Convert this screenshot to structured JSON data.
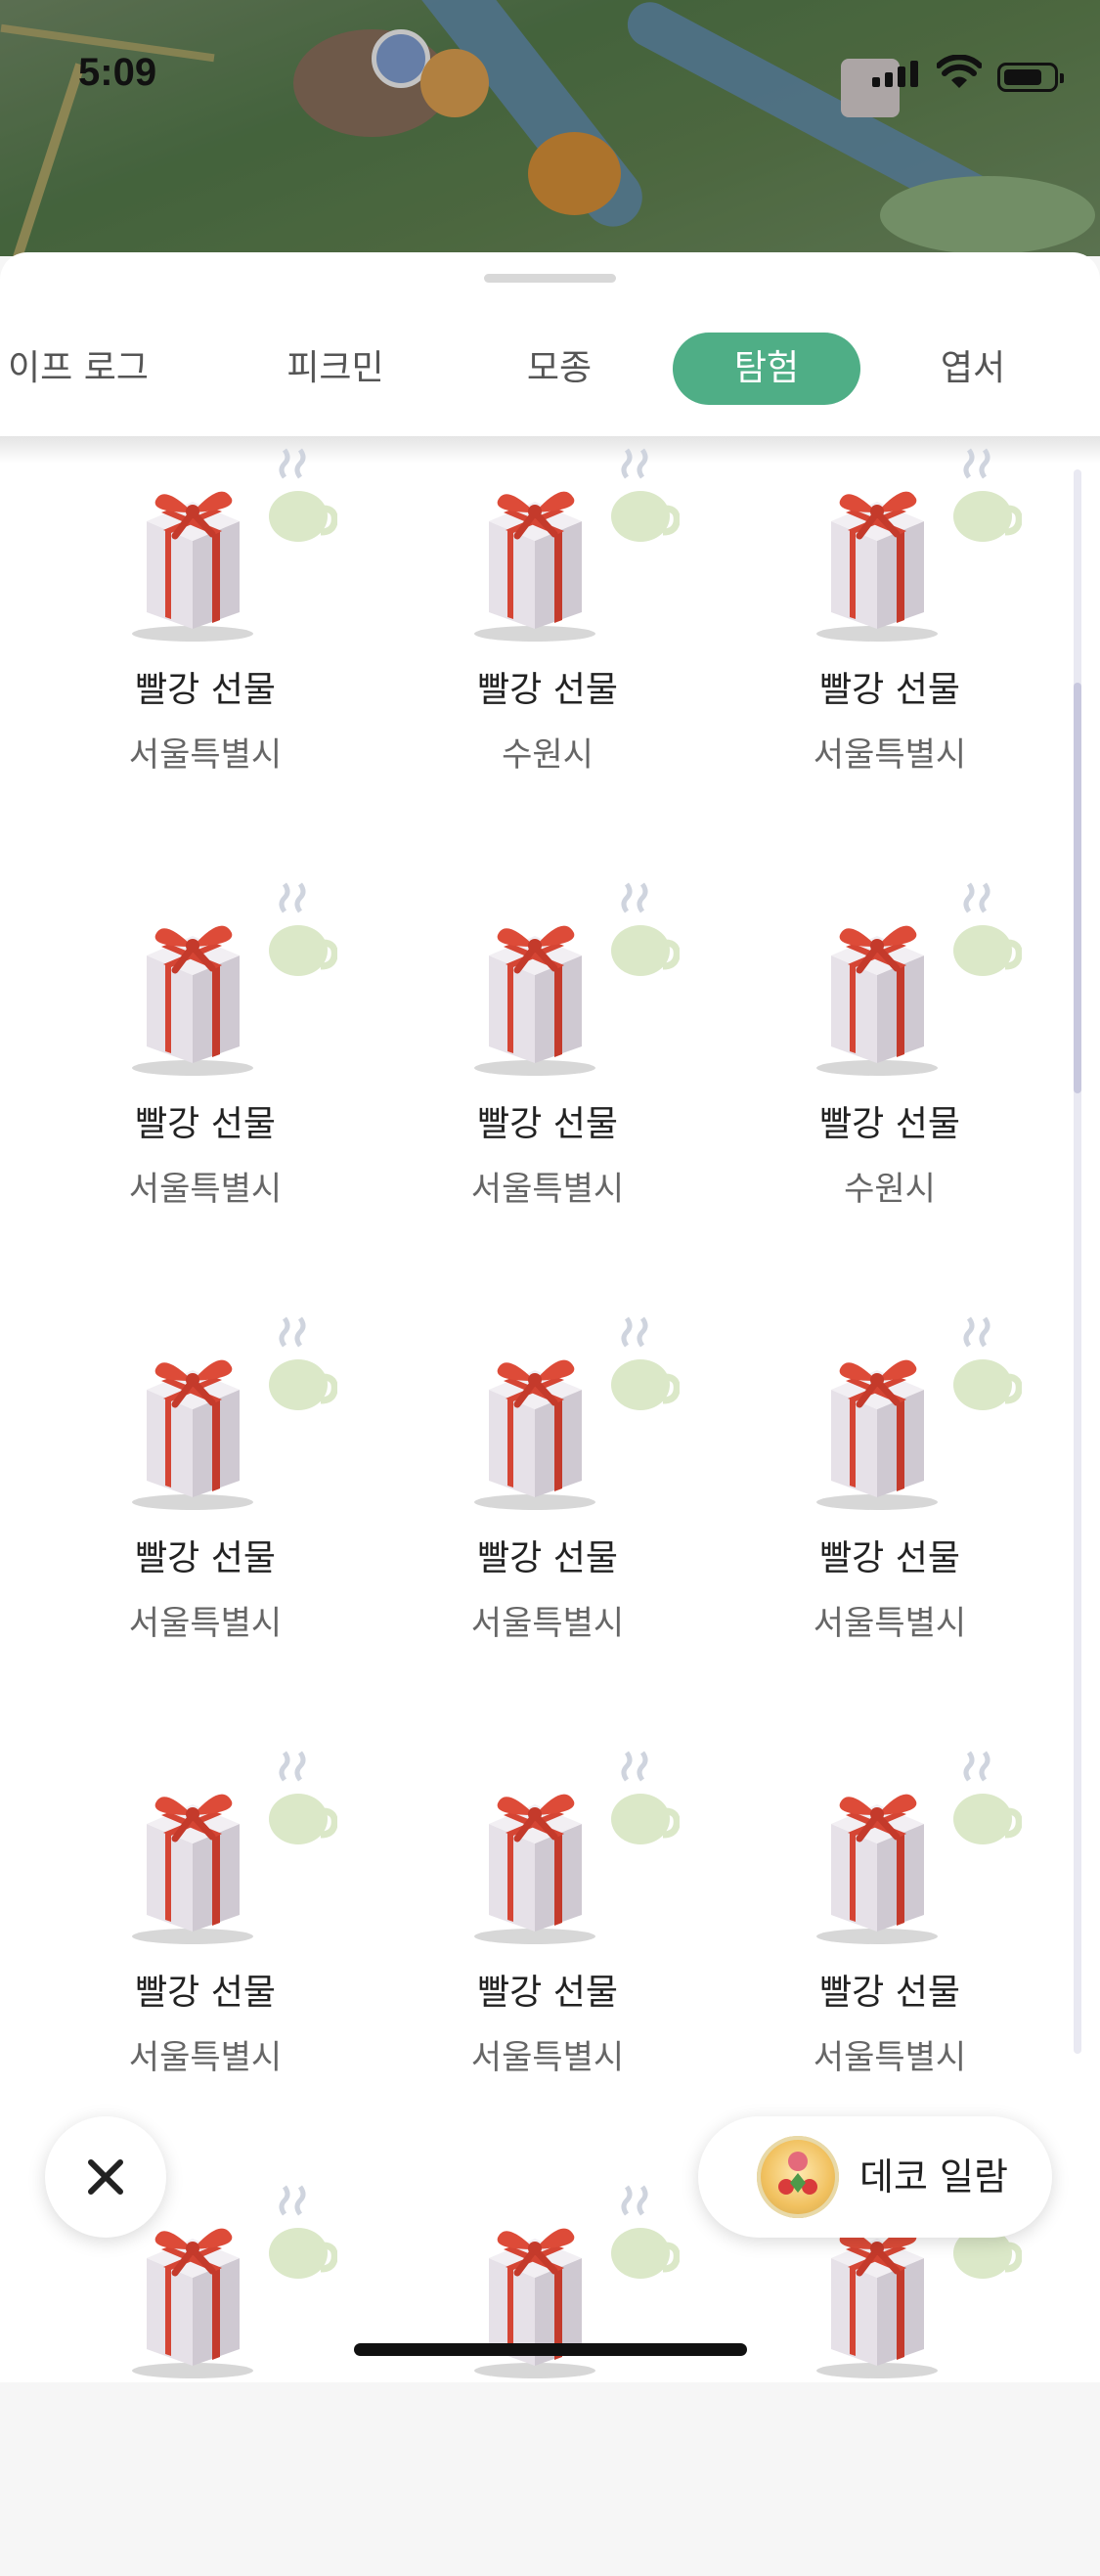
{
  "status": {
    "time": "5:09"
  },
  "tabs": [
    {
      "label": "이프 로그",
      "active": false
    },
    {
      "label": "피크민",
      "active": false
    },
    {
      "label": "모종",
      "active": false
    },
    {
      "label": "탐험",
      "active": true
    },
    {
      "label": "엽서",
      "active": false
    }
  ],
  "items": [
    {
      "name": "빨강 선물",
      "place": "서울특별시"
    },
    {
      "name": "빨강 선물",
      "place": "수원시"
    },
    {
      "name": "빨강 선물",
      "place": "서울특별시"
    },
    {
      "name": "빨강 선물",
      "place": "서울특별시"
    },
    {
      "name": "빨강 선물",
      "place": "서울특별시"
    },
    {
      "name": "빨강 선물",
      "place": "수원시"
    },
    {
      "name": "빨강 선물",
      "place": "서울특별시"
    },
    {
      "name": "빨강 선물",
      "place": "서울특별시"
    },
    {
      "name": "빨강 선물",
      "place": "서울특별시"
    },
    {
      "name": "빨강 선물",
      "place": "서울특별시"
    },
    {
      "name": "빨강 선물",
      "place": "서울특별시"
    },
    {
      "name": "빨강 선물",
      "place": "서울특별시"
    },
    {
      "name": "",
      "place": ""
    },
    {
      "name": "",
      "place": ""
    },
    {
      "name": "",
      "place": ""
    }
  ],
  "buttons": {
    "close_icon": "close-icon",
    "deco_label": "데코 일람"
  },
  "colors": {
    "accent": "#4fae86",
    "ribbon": "#d94a3a",
    "box": "#ece8ee"
  }
}
